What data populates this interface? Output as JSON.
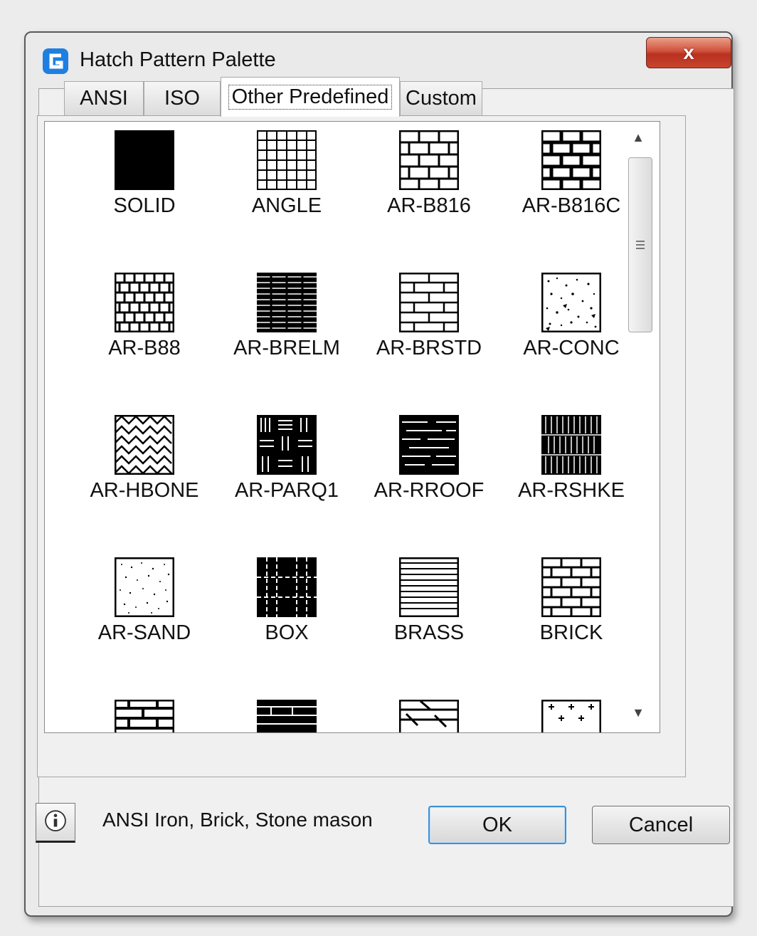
{
  "window": {
    "title": "Hatch Pattern Palette",
    "close_label": "x"
  },
  "tabs": [
    {
      "label": "ANSI"
    },
    {
      "label": "ISO"
    },
    {
      "label": "Other Predefined",
      "active": true
    },
    {
      "label": "Custom"
    }
  ],
  "patterns": [
    {
      "label": "SOLID",
      "icon": "solid"
    },
    {
      "label": "ANGLE",
      "icon": "angle"
    },
    {
      "label": "AR-B816",
      "icon": "brick-large"
    },
    {
      "label": "AR-B816C",
      "icon": "brick-large-c"
    },
    {
      "label": "AR-B88",
      "icon": "brick-small"
    },
    {
      "label": "AR-BRELM",
      "icon": "brelm"
    },
    {
      "label": "AR-BRSTD",
      "icon": "brick-std"
    },
    {
      "label": "AR-CONC",
      "icon": "concrete"
    },
    {
      "label": "AR-HBONE",
      "icon": "herringbone"
    },
    {
      "label": "AR-PARQ1",
      "icon": "parquet"
    },
    {
      "label": "AR-RROOF",
      "icon": "roof"
    },
    {
      "label": "AR-RSHKE",
      "icon": "shake"
    },
    {
      "label": "AR-SAND",
      "icon": "sand"
    },
    {
      "label": "BOX",
      "icon": "box"
    },
    {
      "label": "BRASS",
      "icon": "brass"
    },
    {
      "label": "BRICK",
      "icon": "brick"
    },
    {
      "label": "",
      "icon": "partial-1"
    },
    {
      "label": "",
      "icon": "partial-2"
    },
    {
      "label": "",
      "icon": "partial-3"
    },
    {
      "label": "",
      "icon": "partial-4"
    }
  ],
  "footer": {
    "description": "ANSI Iron, Brick, Stone mason",
    "ok_label": "OK",
    "cancel_label": "Cancel"
  },
  "colors": {
    "close_button": "#c8442c",
    "default_button_border": "#3c8fd6"
  }
}
